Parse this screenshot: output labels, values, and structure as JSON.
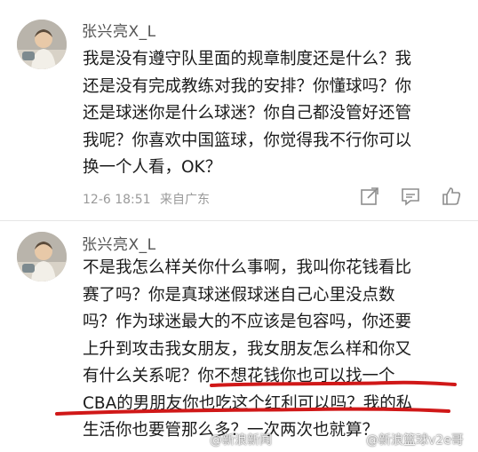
{
  "posts": [
    {
      "username": "张兴亮X_L",
      "lines": [
        "我是没有遵守队里面的规章制度还是什么？我",
        "还是没有完成教练对我的安排？你懂球吗？你",
        "还是球迷你是什么球迷？你自己都没管好还管",
        "我呢？你喜欢中国篮球，你觉得我不行你可以",
        "换一个人看，OK？"
      ],
      "timestamp": "12-6 18:51",
      "source": "来自广东",
      "icons": [
        "share-icon",
        "comment-icon",
        "like-icon"
      ]
    },
    {
      "username": "张兴亮X_L",
      "lines": [
        "不是我怎么样关你什么事啊，我叫你花钱看比",
        "赛了吗？你是真球迷假球迷自己心里没点数",
        "吗？作为球迷最大的不应该是包容吗，你还要",
        "上升到攻击我女朋友，我女朋友怎么样和你又",
        "有什么关系呢？你不想花钱你也可以找一个",
        "CBA的男朋友你也吃这个红利可以吗？我的私",
        "生活你也要管那么多？一次两次也就算？"
      ]
    }
  ],
  "watermarks": [
    "@新浪新闻",
    "@新浪篮球v2e哥"
  ],
  "colors": {
    "text": "#1b1b1b",
    "username": "#555555",
    "meta": "#9a9a9a",
    "underline": "#d01818",
    "background": "#ffffff"
  }
}
